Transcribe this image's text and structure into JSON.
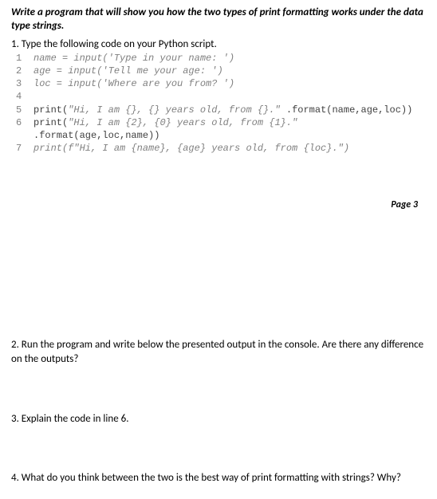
{
  "heading": "Write a program that will show you how the two types of print formatting works under the data type strings.",
  "step1": "1. Type the following code on your Python script.",
  "code": {
    "l1": {
      "num": "1",
      "text": "name = input('Type in your name: ')"
    },
    "l2": {
      "num": "2",
      "text": "age = input('Tell me your age: ')"
    },
    "l3": {
      "num": "3",
      "text": "loc = input('Where are you from? ')"
    },
    "l4": {
      "num": "4",
      "text": ""
    },
    "l5": {
      "num": "5",
      "text_a": "print(",
      "text_b": "\"Hi, I am {}, {} years old, from {}.\"",
      "text_c": " .format(name,age,loc))"
    },
    "l6": {
      "num": "6",
      "text_a": "print(",
      "text_b": "\"Hi, I am {2}, {0} years old, from {1}.\"",
      "text_c": " .format(age,loc,name))"
    },
    "l7": {
      "num": "7",
      "text": "print(f\"Hi, I am {name}, {age} years old, from {loc}.\")"
    }
  },
  "pageNum": "Page 3",
  "q2": "2. Run the program and write below the presented output in the console. Are there any difference on the outputs?",
  "q3": "3. Explain the code in line 6.",
  "q4": "4. What do you think between the two is the best way of print formatting with strings? Why?"
}
